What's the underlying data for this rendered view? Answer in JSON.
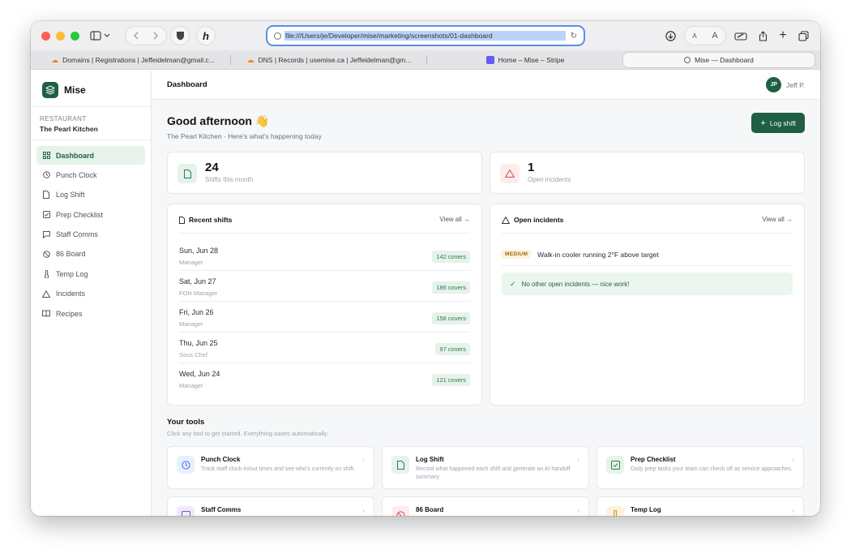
{
  "browser": {
    "url": "file:///Users/je/Developer/mise/marketing/screenshots/01-dashboard",
    "tabs": [
      {
        "label": "Domains | Registrations | Jeffeidelman@gmail.c..."
      },
      {
        "label": "DNS | Records | usemise.ca | Jeffeidelman@gm..."
      },
      {
        "label": "Home – Mise – Stripe"
      },
      {
        "label": "Mise — Dashboard"
      }
    ],
    "text_size_small": "A",
    "text_size_large": "A"
  },
  "app": {
    "brand": "Mise",
    "restaurant_label": "RESTAURANT",
    "restaurant_name": "The Pearl Kitchen",
    "nav": [
      {
        "label": "Dashboard",
        "icon": "grid-icon"
      },
      {
        "label": "Punch Clock",
        "icon": "clock-icon"
      },
      {
        "label": "Log Shift",
        "icon": "file-icon"
      },
      {
        "label": "Prep Checklist",
        "icon": "checklist-icon"
      },
      {
        "label": "Staff Comms",
        "icon": "chat-icon"
      },
      {
        "label": "86 Board",
        "icon": "ban-icon"
      },
      {
        "label": "Temp Log",
        "icon": "thermometer-icon"
      },
      {
        "label": "Incidents",
        "icon": "warning-icon"
      },
      {
        "label": "Recipes",
        "icon": "book-icon"
      }
    ],
    "page_title": "Dashboard",
    "user": {
      "initials": "JP",
      "name": "Jeff P."
    },
    "greeting": "Good afternoon 👋",
    "subgreeting": "The Pearl Kitchen · Here's what's happening today",
    "log_shift_button": "Log shift",
    "stats": [
      {
        "value": "24",
        "label": "Shifts this month"
      },
      {
        "value": "1",
        "label": "Open incidents"
      }
    ],
    "recent_shifts": {
      "title": "Recent shifts",
      "view_all": "View all →",
      "rows": [
        {
          "date": "Sun, Jun 28",
          "role": "Manager",
          "covers": "142 covers"
        },
        {
          "date": "Sat, Jun 27",
          "role": "FOH Manager",
          "covers": "186 covers"
        },
        {
          "date": "Fri, Jun 26",
          "role": "Manager",
          "covers": "158 covers"
        },
        {
          "date": "Thu, Jun 25",
          "role": "Sous Chef",
          "covers": "97 covers"
        },
        {
          "date": "Wed, Jun 24",
          "role": "Manager",
          "covers": "121 covers"
        }
      ]
    },
    "open_incidents": {
      "title": "Open incidents",
      "view_all": "View all →",
      "items": [
        {
          "severity": "MEDIUM",
          "text": "Walk-in cooler running 2°F above target"
        }
      ],
      "ok_message": "No other open incidents — nice work!"
    },
    "tools": {
      "title": "Your tools",
      "subtitle": "Click any tool to get started. Everything saves automatically.",
      "items": [
        {
          "name": "Punch Clock",
          "desc": "Track staff clock-in/out times and see who's currently on shift."
        },
        {
          "name": "Log Shift",
          "desc": "Record what happened each shift and generate an AI handoff summary."
        },
        {
          "name": "Prep Checklist",
          "desc": "Daily prep tasks your team can check off as service approaches."
        },
        {
          "name": "Staff Comms",
          "desc": ""
        },
        {
          "name": "86 Board",
          "desc": ""
        },
        {
          "name": "Temp Log",
          "desc": ""
        }
      ]
    }
  }
}
